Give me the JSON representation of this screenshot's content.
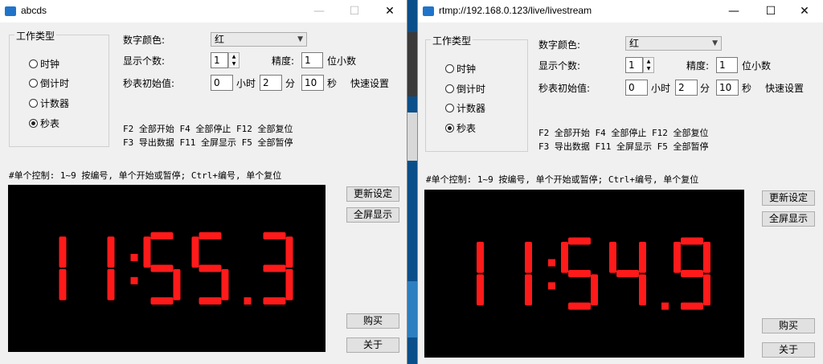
{
  "left": {
    "title": "abcds",
    "controls": {
      "min": "—",
      "max": "☐",
      "close": "✕"
    },
    "group_label": "工作类型",
    "radios": [
      "时钟",
      "倒计时",
      "计数器",
      "秒表"
    ],
    "selected_index": 3,
    "color_label": "数字颜色:",
    "color_value": "红",
    "count_label": "显示个数:",
    "count_value": "1",
    "precision_label": "精度:",
    "precision_value": "1",
    "precision_unit": "位小数",
    "init_label": "秒表初始值:",
    "init_hours": "0",
    "hours_unit": "小时",
    "init_minutes": "2",
    "minutes_unit": "分",
    "init_seconds": "10",
    "seconds_unit": "秒",
    "quick_set": "快速设置",
    "hotkeys_line1": "F2 全部开始 F4 全部停止 F12 全部复位",
    "hotkeys_line2": "F3 导出数据 F11 全屏显示 F5 全部暂停",
    "single_control": "#单个控制: 1~9 按编号, 单个开始或暂停; Ctrl+编号, 单个复位",
    "time_display": "11:55.3",
    "digit_color": "#ff1a1a",
    "btn_update": "更新设定",
    "btn_fullscreen": "全屏显示",
    "btn_buy": "购买",
    "btn_about": "关于"
  },
  "right": {
    "title": "rtmp://192.168.0.123/live/livestream",
    "controls": {
      "min": "—",
      "max": "☐",
      "close": "✕"
    },
    "group_label": "工作类型",
    "radios": [
      "时钟",
      "倒计时",
      "计数器",
      "秒表"
    ],
    "selected_index": 3,
    "color_label": "数字颜色:",
    "color_value": "红",
    "count_label": "显示个数:",
    "count_value": "1",
    "precision_label": "精度:",
    "precision_value": "1",
    "precision_unit": "位小数",
    "init_label": "秒表初始值:",
    "init_hours": "0",
    "hours_unit": "小时",
    "init_minutes": "2",
    "minutes_unit": "分",
    "init_seconds": "10",
    "seconds_unit": "秒",
    "quick_set": "快速设置",
    "hotkeys_line1": "F2 全部开始 F4 全部停止 F12 全部复位",
    "hotkeys_line2": "F3 导出数据 F11 全屏显示 F5 全部暂停",
    "single_control": "#单个控制: 1~9 按编号, 单个开始或暂停; Ctrl+编号, 单个复位",
    "time_display": "11:54.9",
    "digit_color": "#ff1a1a",
    "btn_update": "更新设定",
    "btn_fullscreen": "全屏显示",
    "btn_buy": "购买",
    "btn_about": "关于"
  }
}
